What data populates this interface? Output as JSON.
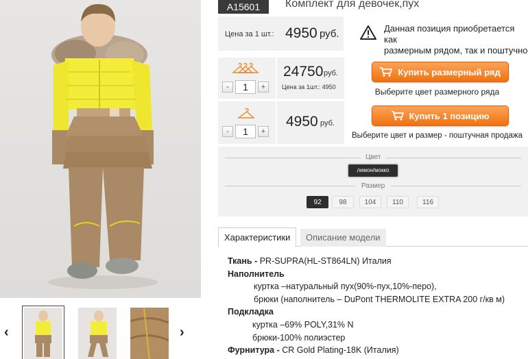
{
  "product": {
    "sku": "А15601",
    "title": "Комплект для девочек,пух"
  },
  "single_price": {
    "label": "Цена за 1 шт.:",
    "value": "4950",
    "currency": "руб."
  },
  "notice": {
    "icon": "warning-icon",
    "line1": "Данная позиция приобретается как",
    "line2": "размерным рядом, так и поштучно"
  },
  "size_row_offer": {
    "quantity": "1",
    "price": "24750",
    "currency": "руб.",
    "unit_price_note": "Цена за 1шт.: 4950",
    "button_label": "Купить размерный ряд",
    "hint": "Выберите цвет размерного ряда"
  },
  "single_offer": {
    "quantity": "1",
    "price": "4950",
    "currency": "руб.",
    "button_label": "Купить 1 позицию",
    "hint": "Выберите цвет и размер - поштучная продажа"
  },
  "stepper": {
    "minus": "-",
    "plus": "+"
  },
  "options": {
    "color_label": "Цвет",
    "color_value": "лимон/мокко",
    "size_label": "Размер",
    "sizes": [
      "92",
      "98",
      "104",
      "110",
      "116"
    ],
    "selected_size": "92"
  },
  "tabs": [
    {
      "label": "Характеристики"
    },
    {
      "label": "Описание модели"
    }
  ],
  "specs": {
    "fabric_label": "Ткань -",
    "fabric_value": " PR-SUPRA(HL-ST864LN) Италия",
    "filler_label": "Наполнитель",
    "filler_jacket": "куртка –натуральный пух(90%-пух,10%-перо),",
    "filler_pants": "брюки (наполнитель – DuPont THERMOLITE EXTRA 200 г/кв м)",
    "lining_label": "Подкладка",
    "lining_jacket": "куртка –69% POLY,31% N",
    "lining_pants": "брюки-100% полиэстер",
    "hardware_label": "Фурнитура -",
    "hardware_value": " CR Gold Plating-18K (Италия)"
  },
  "gallery": {
    "prev_icon": "‹",
    "next_icon": "›"
  },
  "colors": {
    "accent_orange": "#f0720f",
    "jacket_yellow": "#f2ec3a",
    "mocha": "#a98966",
    "panel_bg": "#f1f1f1"
  }
}
